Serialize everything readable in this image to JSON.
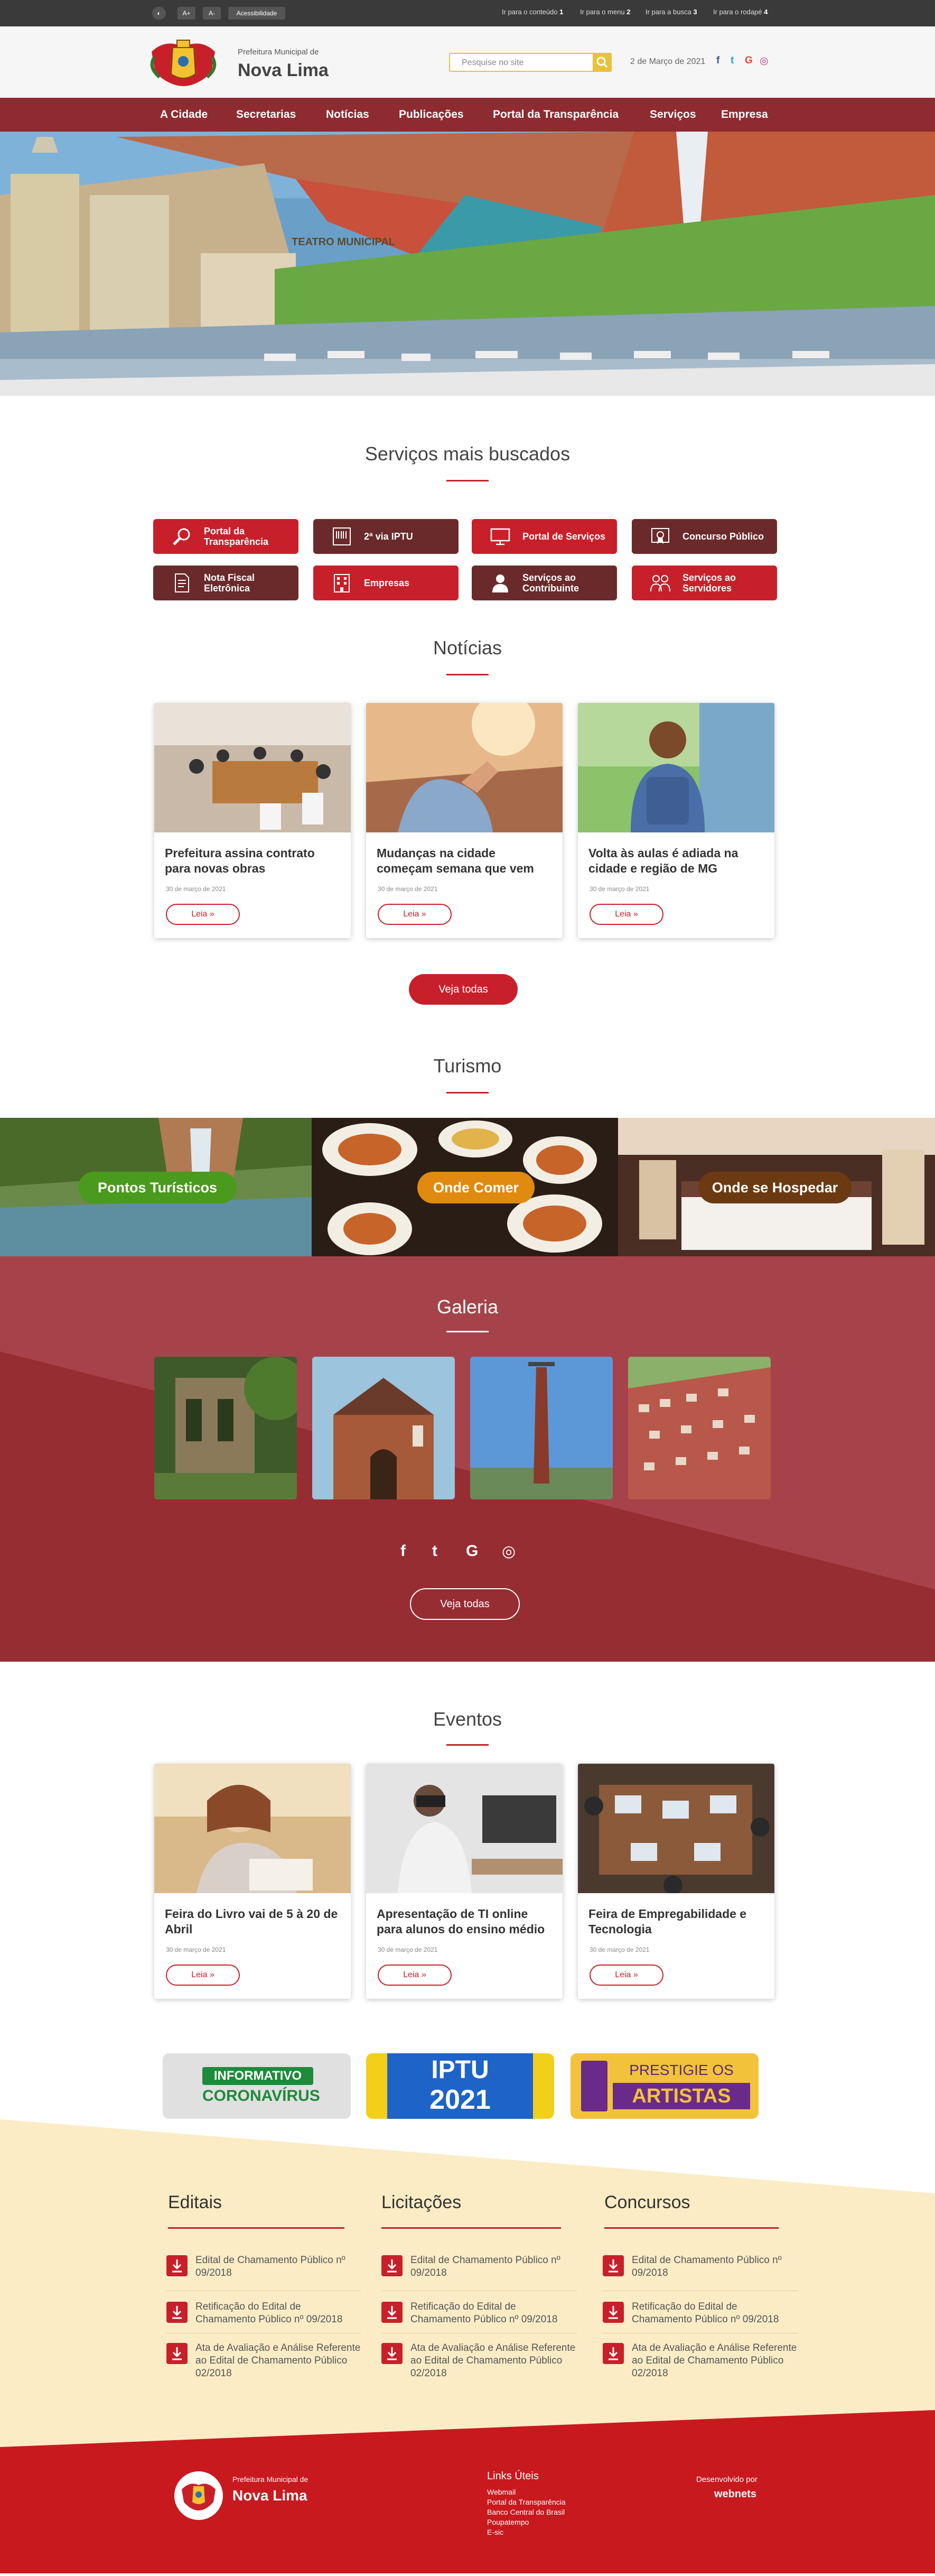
{
  "topbar": {
    "contrast_label": "◐",
    "font_increase": "A+",
    "font_decrease": "A-",
    "accessibility": "Acessibilidade",
    "skip_links": [
      {
        "label": "Ir para o conteúdo",
        "key": "1"
      },
      {
        "label": "Ir para o menu",
        "key": "2"
      },
      {
        "label": "Ir para a busca",
        "key": "3"
      },
      {
        "label": "Ir para o rodapé",
        "key": "4"
      }
    ]
  },
  "header": {
    "subtitle": "Prefeitura Municipal de",
    "title": "Nova Lima",
    "search_placeholder": "Pesquise no site",
    "date": "2 de Março de 2021",
    "social": [
      "f",
      "t",
      "G",
      "◎"
    ]
  },
  "nav": {
    "items": [
      "A Cidade",
      "Secretarias",
      "Notícias",
      "Publicações",
      "Portal da Transparência",
      "Serviços",
      "Empresa"
    ]
  },
  "hero": {
    "sign": "TEATRO MUNICIPAL"
  },
  "services": {
    "title": "Serviços mais buscados",
    "items": [
      {
        "label": "Portal da Transparência",
        "icon": "magnifier-icon",
        "style": "red"
      },
      {
        "label": "2ª via IPTU",
        "icon": "barcode-document-icon",
        "style": "dark"
      },
      {
        "label": "Portal de Serviços",
        "icon": "monitor-icon",
        "style": "red"
      },
      {
        "label": "Concurso Público",
        "icon": "certificate-icon",
        "style": "dark"
      },
      {
        "label": "Nota Fiscal Eletrônica",
        "icon": "document-icon",
        "style": "dark"
      },
      {
        "label": "Empresas",
        "icon": "building-icon",
        "style": "red"
      },
      {
        "label": "Serviços ao Contribuinte",
        "icon": "person-icon",
        "style": "dark"
      },
      {
        "label": "Serviços ao Servidores",
        "icon": "people-icon",
        "style": "red"
      }
    ]
  },
  "news": {
    "title": "Notícias",
    "items": [
      {
        "title": "Prefeitura assina contrato para novas obras",
        "date": "30 de março de 2021",
        "button": "Leia »"
      },
      {
        "title": "Mudanças na cidade começam semana que vem",
        "date": "30 de março de 2021",
        "button": "Leia »"
      },
      {
        "title": "Volta às aulas é adiada na cidade e região de MG",
        "date": "30 de março de 2021",
        "button": "Leia »"
      }
    ],
    "see_all": "Veja todas"
  },
  "tourism": {
    "title": "Turismo",
    "items": [
      {
        "label": "Pontos Turísticos",
        "color": "#4a9a1e"
      },
      {
        "label": "Onde Comer",
        "color": "#e08a10"
      },
      {
        "label": "Onde se Hospedar",
        "color": "#6b3a12"
      }
    ]
  },
  "gallery": {
    "title": "Galeria",
    "social": [
      "f",
      "t",
      "G",
      "◎"
    ],
    "see_all": "Veja todas"
  },
  "events": {
    "title": "Eventos",
    "items": [
      {
        "title": "Feira do Livro vai de 5 à 20 de Abril",
        "date": "30 de março de 2021",
        "button": "Leia »"
      },
      {
        "title": "Apresentação de TI online para alunos do ensino médio",
        "date": "30 de março de 2021",
        "button": "Leia »"
      },
      {
        "title": "Feira de Empregabilidade e Tecnologia",
        "date": "30 de março de 2021",
        "button": "Leia »"
      }
    ]
  },
  "banners": [
    {
      "line1": "INFORMATIVO",
      "line2": "CORONAVÍRUS"
    },
    {
      "line1": "IPTU",
      "line2": "2021"
    },
    {
      "line1": "PRESTIGIE OS",
      "line2": "ARTISTAS"
    }
  ],
  "docs": {
    "columns": [
      {
        "title": "Editais",
        "items": [
          "Edital de Chamamento Público nº 09/2018",
          "Retificação do Edital de Chamamento Público nº 09/2018",
          "Ata de Avaliação e Análise Referente ao Edital de Chamamento Público 02/2018"
        ]
      },
      {
        "title": "Licitações",
        "items": [
          "Edital de Chamamento Público nº 09/2018",
          "Retificação do Edital de Chamamento Público nº 09/2018",
          "Ata de Avaliação e Análise Referente ao Edital de Chamamento Público 02/2018"
        ]
      },
      {
        "title": "Concursos",
        "items": [
          "Edital de Chamamento Público nº 09/2018",
          "Retificação do Edital de Chamamento Público nº 09/2018",
          "Ata de Avaliação e Análise Referente ao Edital de Chamamento Público 02/2018"
        ]
      }
    ]
  },
  "footer": {
    "subtitle": "Prefeitura Municipal de",
    "title": "Nova Lima",
    "links_title": "Links Úteis",
    "links": [
      "Webmail",
      "Portal da Transparência",
      "Banco Central do Brasil",
      "Poupatempo",
      "E-sic"
    ],
    "dev_label": "Desenvolvido por",
    "dev_name": "webnets"
  }
}
